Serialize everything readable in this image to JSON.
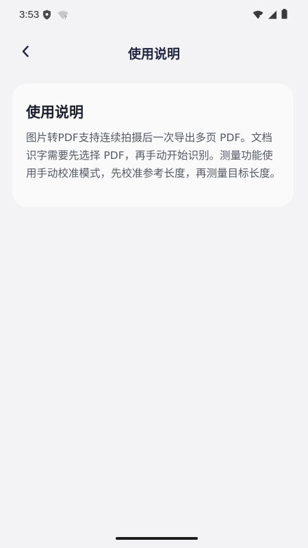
{
  "status_bar": {
    "time": "3:53",
    "icons": [
      "shield-icon",
      "wifi-question-icon",
      "wifi-icon",
      "signal-icon",
      "battery-icon"
    ]
  },
  "app_bar": {
    "title": "使用说明",
    "back_icon": "chevron-left-icon"
  },
  "card": {
    "title": "使用说明",
    "body": "图片转PDF支持连续拍摄后一次导出多页 PDF。文档识字需要先选择 PDF，再手动开始识别。测量功能使用手动校准模式，先校准参考长度，再测量目标长度。"
  },
  "colors": {
    "background": "#f3f3f5",
    "card": "#fafafa",
    "title": "#1f2540",
    "body_text": "#555a66"
  }
}
